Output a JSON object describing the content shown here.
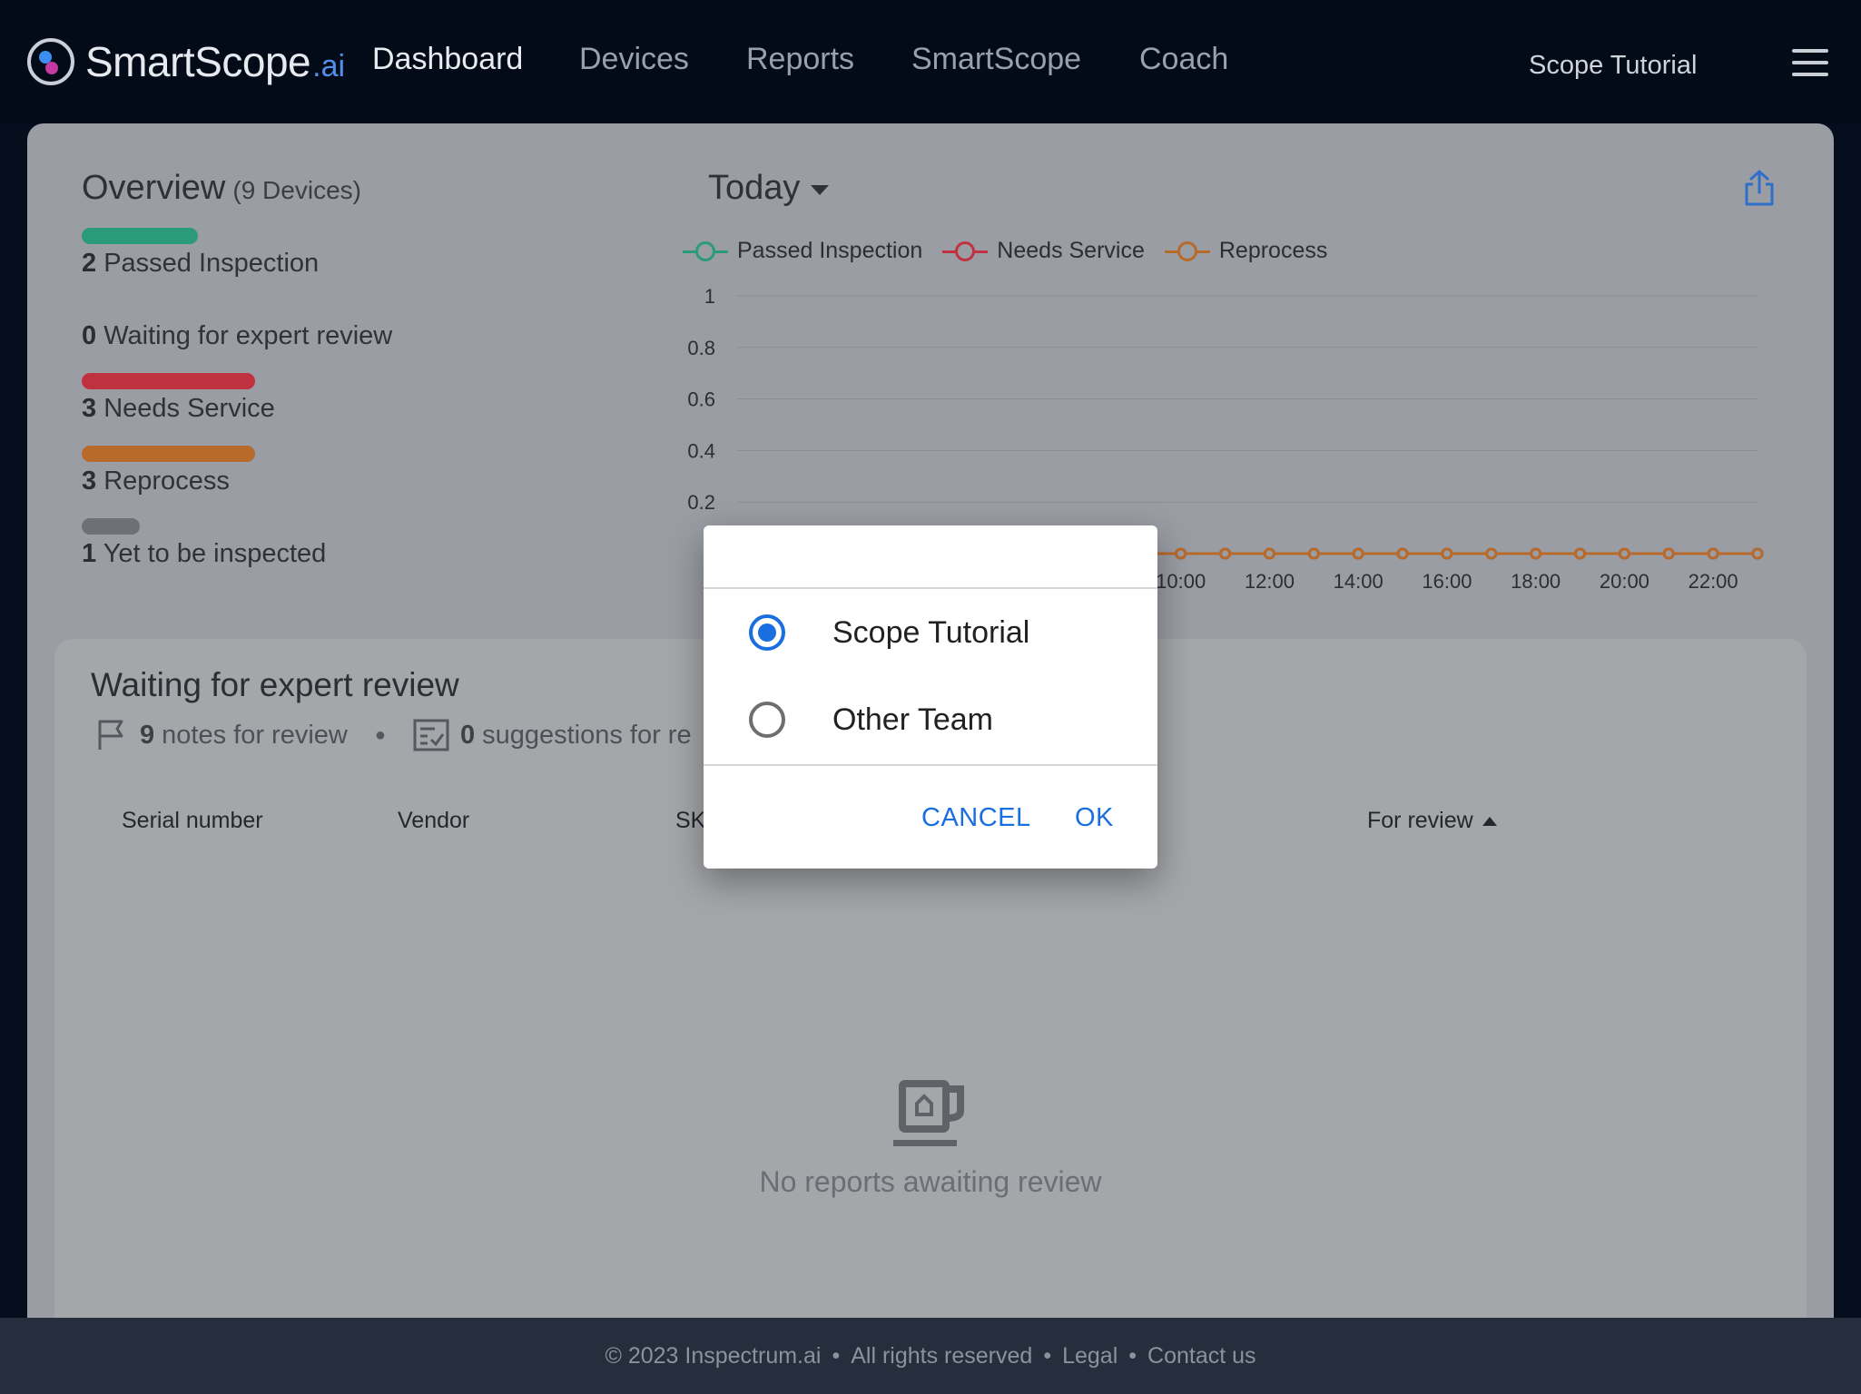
{
  "nav": {
    "logo_main": "SmartScope",
    "logo_suffix": ".ai",
    "links": [
      {
        "label": "Dashboard",
        "active": true
      },
      {
        "label": "Devices"
      },
      {
        "label": "Reports"
      },
      {
        "label": "SmartScope"
      },
      {
        "label": "Coach"
      }
    ],
    "team": "Scope Tutorial"
  },
  "overview": {
    "title": "Overview",
    "device_count": "(9 Devices)",
    "stats": [
      {
        "count": "2",
        "label": "Passed Inspection",
        "color": "#2a9a78",
        "fraction": 0.22
      },
      {
        "count": "0",
        "label": "Waiting for expert review",
        "color": "",
        "fraction": 0
      },
      {
        "count": "3",
        "label": "Needs Service",
        "color": "#c0323f",
        "fraction": 0.33
      },
      {
        "count": "3",
        "label": "Reprocess",
        "color": "#b86a2a",
        "fraction": 0.33
      },
      {
        "count": "1",
        "label": "Yet to be inspected",
        "color": "#6e7075",
        "fraction": 0.11
      }
    ]
  },
  "range": {
    "label": "Today"
  },
  "chart_data": {
    "type": "line",
    "x": [
      "00:00",
      "01:00",
      "02:00",
      "03:00",
      "04:00",
      "05:00",
      "06:00",
      "07:00",
      "08:00",
      "09:00",
      "10:00",
      "11:00",
      "12:00",
      "13:00",
      "14:00",
      "15:00",
      "16:00",
      "17:00",
      "18:00",
      "19:00",
      "20:00",
      "21:00",
      "22:00",
      "23:00"
    ],
    "x_tick_labels": [
      "10:00",
      "12:00",
      "14:00",
      "16:00",
      "18:00",
      "20:00",
      "22:00"
    ],
    "ylim": [
      0,
      1
    ],
    "y_ticks": [
      "1",
      "0.8",
      "0.6",
      "0.4",
      "0.2"
    ],
    "grid": true,
    "legend_position": "top-left",
    "series": [
      {
        "name": "Passed Inspection",
        "color": "#2a9a78",
        "values": [
          0,
          0,
          0,
          0,
          0,
          0,
          0,
          0,
          0,
          0,
          0,
          0,
          0,
          0,
          0,
          0,
          0,
          0,
          0,
          0,
          0,
          0,
          0,
          0
        ]
      },
      {
        "name": "Needs Service",
        "color": "#c0323f",
        "values": [
          0,
          0,
          0,
          0,
          0,
          0,
          0,
          0,
          0,
          0,
          0,
          0,
          0,
          0,
          0,
          0,
          0,
          0,
          0,
          0,
          0,
          0,
          0,
          0
        ]
      },
      {
        "name": "Reprocess",
        "color": "#b86a2a",
        "values": [
          0,
          0,
          0,
          0,
          0,
          0,
          0,
          0,
          0,
          0,
          0,
          0,
          0,
          0,
          0,
          0,
          0,
          0,
          0,
          0,
          0,
          0,
          0,
          0
        ]
      }
    ]
  },
  "review": {
    "title": "Waiting for expert review",
    "notes_count": "9",
    "notes_label": "notes for review",
    "suggestions_count": "0",
    "suggestions_label": "suggestions for re",
    "columns": [
      "Serial number",
      "Vendor",
      "SK",
      "For review"
    ],
    "empty_text": "No reports awaiting review"
  },
  "footer": {
    "copyright": "© 2023 Inspectrum.ai",
    "rights": "All rights reserved",
    "legal": "Legal",
    "contact": "Contact us"
  },
  "dialog": {
    "options": [
      {
        "label": "Scope Tutorial",
        "checked": true
      },
      {
        "label": "Other Team",
        "checked": false
      }
    ],
    "cancel": "CANCEL",
    "ok": "OK"
  }
}
